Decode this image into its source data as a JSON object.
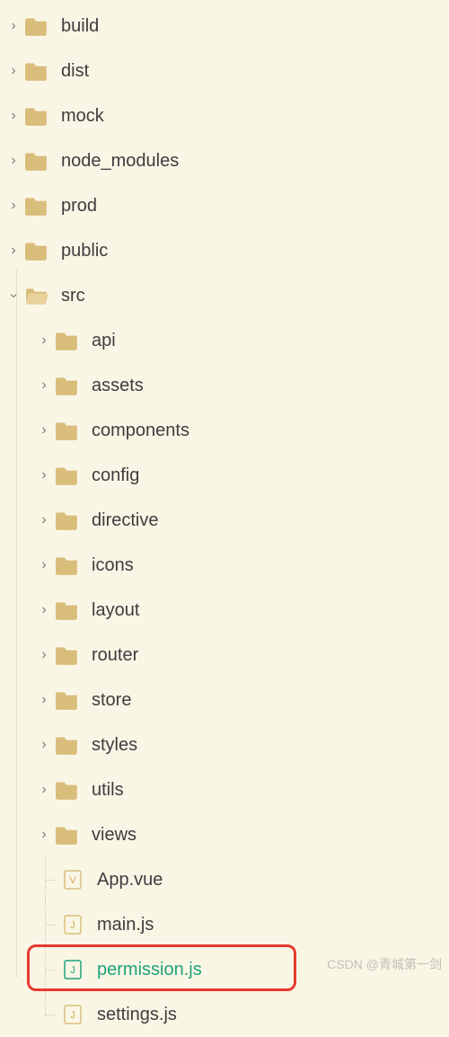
{
  "tree": {
    "root": [
      {
        "label": "build",
        "expanded": false,
        "type": "folder"
      },
      {
        "label": "dist",
        "expanded": false,
        "type": "folder"
      },
      {
        "label": "mock",
        "expanded": false,
        "type": "folder"
      },
      {
        "label": "node_modules",
        "expanded": false,
        "type": "folder"
      },
      {
        "label": "prod",
        "expanded": false,
        "type": "folder"
      },
      {
        "label": "public",
        "expanded": false,
        "type": "folder"
      },
      {
        "label": "src",
        "expanded": true,
        "type": "folder"
      }
    ],
    "src_children": [
      {
        "label": "api",
        "type": "folder"
      },
      {
        "label": "assets",
        "type": "folder"
      },
      {
        "label": "components",
        "type": "folder"
      },
      {
        "label": "config",
        "type": "folder"
      },
      {
        "label": "directive",
        "type": "folder"
      },
      {
        "label": "icons",
        "type": "folder"
      },
      {
        "label": "layout",
        "type": "folder"
      },
      {
        "label": "router",
        "type": "folder"
      },
      {
        "label": "store",
        "type": "folder"
      },
      {
        "label": "styles",
        "type": "folder"
      },
      {
        "label": "utils",
        "type": "folder"
      },
      {
        "label": "views",
        "type": "folder"
      },
      {
        "label": "App.vue",
        "type": "vue"
      },
      {
        "label": "main.js",
        "type": "js"
      },
      {
        "label": "permission.js",
        "type": "js",
        "open": true,
        "highlighted": true
      },
      {
        "label": "settings.js",
        "type": "js"
      }
    ]
  },
  "watermark": "CSDN @青城第一剑"
}
